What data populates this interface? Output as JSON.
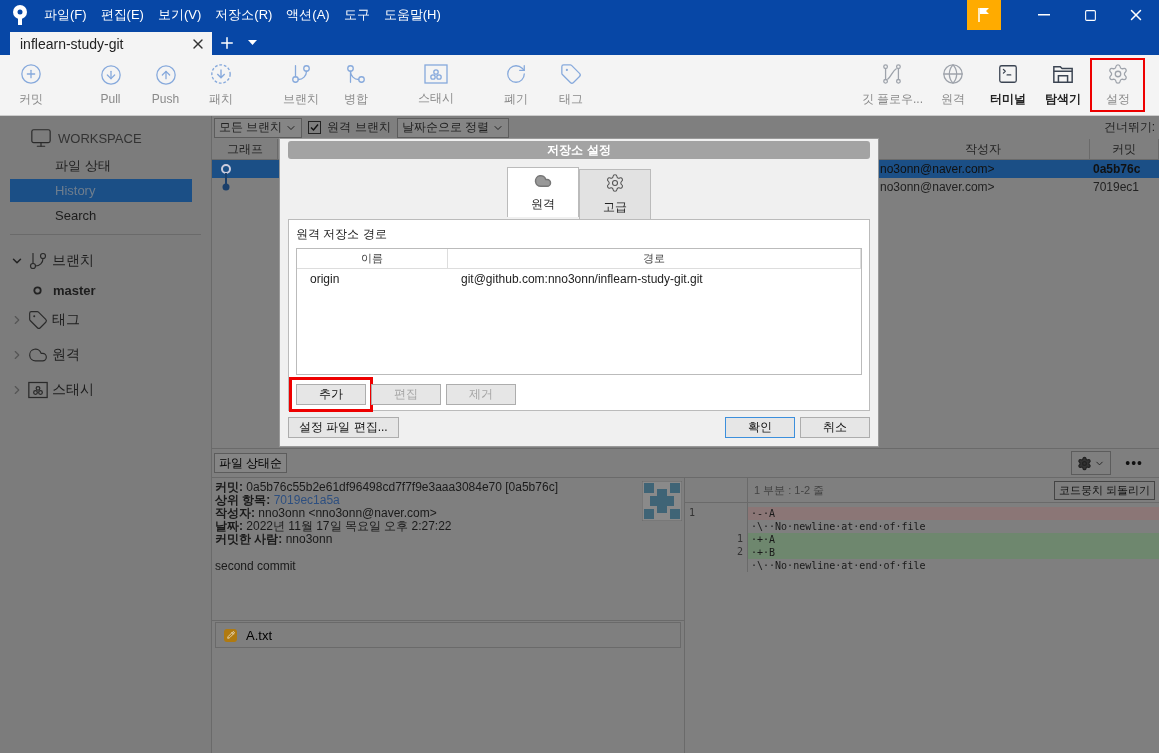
{
  "menu": [
    "파일(F)",
    "편집(E)",
    "보기(V)",
    "저장소(R)",
    "액션(A)",
    "도구",
    "도움말(H)"
  ],
  "tabs": [
    {
      "label": "inflearn-study-git",
      "selected": true
    }
  ],
  "toolbar": {
    "left": [
      [
        {
          "label": "커밋",
          "disabled": true
        }
      ],
      [
        {
          "label": "Pull",
          "disabled": true
        },
        {
          "label": "Push",
          "disabled": true
        },
        {
          "label": "패치",
          "disabled": true
        }
      ],
      [
        {
          "label": "브랜치",
          "disabled": true
        },
        {
          "label": "병합",
          "disabled": true
        }
      ],
      [
        {
          "label": "스태시",
          "disabled": true
        }
      ],
      [
        {
          "label": "폐기",
          "disabled": true
        },
        {
          "label": "태그",
          "disabled": true
        }
      ]
    ],
    "right": [
      {
        "label": "깃 플로우...",
        "disabled": true,
        "highlighted": false
      },
      {
        "label": "원격",
        "disabled": true,
        "highlighted": false
      },
      {
        "label": "터미널",
        "disabled": false,
        "highlighted": false
      },
      {
        "label": "탐색기",
        "disabled": false,
        "highlighted": false
      },
      {
        "label": "설정",
        "disabled": true,
        "highlighted": true
      }
    ]
  },
  "sidebar": {
    "workspace": {
      "title": "WORKSPACE",
      "items": [
        {
          "label": "파일 상태",
          "selected": false
        },
        {
          "label": "History",
          "selected": true
        },
        {
          "label": "Search",
          "selected": false
        }
      ]
    },
    "sections": [
      {
        "label": "브랜치",
        "expanded": true,
        "children": [
          {
            "label": "master"
          }
        ]
      },
      {
        "label": "태그",
        "expanded": false
      },
      {
        "label": "원격",
        "expanded": false
      },
      {
        "label": "스태시",
        "expanded": false
      }
    ]
  },
  "history": {
    "branch_filter": "모든 브랜치",
    "remote_branches": {
      "label": "원격 브랜치",
      "checked": true
    },
    "sort": "날짜순으로 정렬",
    "jump": "건너뛰기:",
    "columns": [
      "그래프",
      "작성자",
      "커밋"
    ],
    "rows": [
      {
        "author": "no3onn@naver.com>",
        "commit": "0a5b76c",
        "selected": true
      },
      {
        "author": "no3onn@naver.com>",
        "commit": "7019ec1",
        "selected": false
      }
    ]
  },
  "details": {
    "file_filter": "파일 상태순",
    "lines": [
      {
        "label": "커밋:",
        "value": "0a5b76c55b2e61df96498cd7f7f9e3aaa3084e70 [0a5b76c]",
        "link": false
      },
      {
        "label": "상위 항목:",
        "value": "7019ec1a5a",
        "link": true
      },
      {
        "label": "작성자:",
        "value": "nno3onn <nno3onn@naver.com>",
        "link": false
      },
      {
        "label": "날짜:",
        "value": "2022년 11월 17일 목요일 오후 2:27:22",
        "link": false
      },
      {
        "label": "커밋한 사람:",
        "value": "nno3onn",
        "link": false
      }
    ],
    "message": "second commit",
    "files": [
      {
        "name": "A.txt"
      }
    ]
  },
  "diff": {
    "more": "•••",
    "hunk": "1 부분 : 1-2 줄",
    "discard": "코드뭉치 되돌리기",
    "lines": [
      {
        "kind": "removed",
        "old": "1",
        "text": "·-·A"
      },
      {
        "kind": "context",
        "text": "·\\··No·newline·at·end·of·file"
      },
      {
        "kind": "added",
        "new": "1",
        "text": "·+·A"
      },
      {
        "kind": "added",
        "new": "2",
        "text": "·+·B"
      },
      {
        "kind": "context",
        "text": "·\\··No·newline·at·end·of·file"
      }
    ]
  },
  "dialog": {
    "title": "저장소 설정",
    "tabs": [
      {
        "label": "원격",
        "selected": true
      },
      {
        "label": "고급",
        "selected": false
      }
    ],
    "section": "원격 저장소 경로",
    "columns": [
      "이름",
      "경로"
    ],
    "rows": [
      {
        "name": "origin",
        "path": "git@github.com:nno3onn/inflearn-study-git.git"
      }
    ],
    "buttons": [
      {
        "label": "추가",
        "disabled": false,
        "highlighted": true
      },
      {
        "label": "편집",
        "disabled": true,
        "highlighted": false
      },
      {
        "label": "제거",
        "disabled": true,
        "highlighted": false
      }
    ],
    "edit_config": "설정 파일 편집...",
    "ok": "확인",
    "cancel": "취소"
  }
}
